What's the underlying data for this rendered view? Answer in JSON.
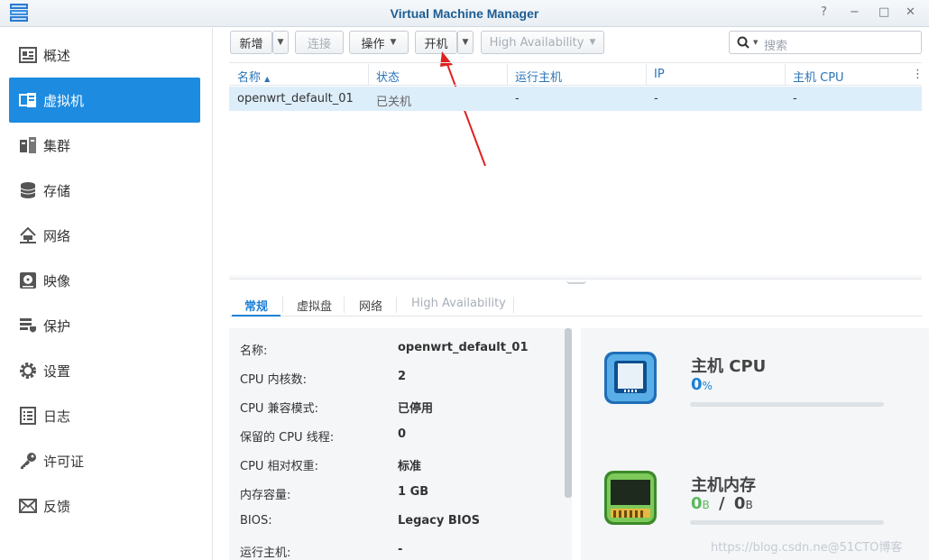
{
  "window": {
    "title": "Virtual Machine Manager",
    "controls": {
      "help": "?",
      "minimize": "−",
      "maximize": "□",
      "close": "✕"
    }
  },
  "sidebar": {
    "items": [
      {
        "label": "概述",
        "icon": "overview-icon"
      },
      {
        "label": "虚拟机",
        "icon": "virtual-machine-icon",
        "active": true
      },
      {
        "label": "集群",
        "icon": "cluster-icon"
      },
      {
        "label": "存储",
        "icon": "storage-icon"
      },
      {
        "label": "网络",
        "icon": "network-icon"
      },
      {
        "label": "映像",
        "icon": "image-icon"
      },
      {
        "label": "保护",
        "icon": "protection-icon"
      },
      {
        "label": "设置",
        "icon": "gear-icon"
      },
      {
        "label": "日志",
        "icon": "log-icon"
      },
      {
        "label": "许可证",
        "icon": "license-key-icon"
      },
      {
        "label": "反馈",
        "icon": "feedback-mail-icon"
      }
    ]
  },
  "toolbar": {
    "new_label": "新增",
    "connect_label": "连接",
    "action_label": "操作",
    "power_on_label": "开机",
    "ha_label": "High Availability",
    "search_placeholder": "搜索"
  },
  "grid": {
    "columns": [
      "名称",
      "状态",
      "运行主机",
      "IP",
      "主机 CPU"
    ],
    "rows": [
      {
        "name": "openwrt_default_01",
        "status": "已关机",
        "host": "-",
        "ip": "-",
        "cpu": "-"
      }
    ]
  },
  "detail_tabs": [
    "常规",
    "虚拟盘",
    "网络",
    "High Availability"
  ],
  "details": [
    {
      "key": "名称:",
      "value": "openwrt_default_01"
    },
    {
      "key": "CPU 内核数:",
      "value": "2"
    },
    {
      "key": "CPU 兼容模式:",
      "value": "已停用"
    },
    {
      "key": "保留的 CPU 线程:",
      "value": "0"
    },
    {
      "key": "CPU 相对权重:",
      "value": "标准"
    },
    {
      "key": "内存容量:",
      "value": "1 GB"
    },
    {
      "key": "BIOS:",
      "value": "Legacy BIOS"
    },
    {
      "key": "运行主机:",
      "value": "-"
    }
  ],
  "gauges": {
    "cpu": {
      "title": "主机 CPU",
      "value": "0",
      "unit": "%",
      "usage": 0,
      "color": "#1d80d6"
    },
    "memory": {
      "title": "主机内存",
      "used": "0",
      "used_unit": "B",
      "sep": "/",
      "total": "0",
      "total_unit": "B",
      "usage": 0,
      "color": "#5cb85c"
    }
  },
  "watermark": "https://blog.csdn.ne@51CTO博客",
  "colors": {
    "accent": "#1d8be0",
    "link": "#2a74b8",
    "selection": "#ddeefb"
  }
}
